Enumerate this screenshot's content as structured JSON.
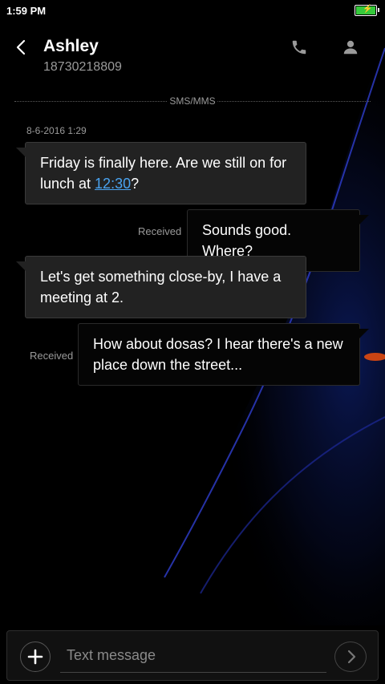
{
  "status": {
    "time": "1:59 PM"
  },
  "header": {
    "contact_name": "Ashley",
    "contact_number": "18730218809"
  },
  "thread": {
    "channel_label": "SMS/MMS",
    "timestamp": "8-6-2016 1:29",
    "messages": [
      {
        "direction": "incoming",
        "text_before": "Friday is finally here. Are we still on for lunch at ",
        "link": "12:30",
        "text_after": "?"
      },
      {
        "direction": "outgoing",
        "status": "Received",
        "text": "Sounds good. Where?"
      },
      {
        "direction": "incoming",
        "text": "Let's get something close-by, I have a meeting at 2."
      },
      {
        "direction": "outgoing",
        "status": "Received",
        "text": "How about dosas? I hear there's a new place down the street..."
      }
    ]
  },
  "compose": {
    "placeholder": "Text message"
  },
  "colors": {
    "link": "#4aa3f0",
    "battery": "#35c93b",
    "bubble_incoming": "#222222",
    "bubble_outgoing": "#050505"
  },
  "icons": [
    "back-icon",
    "phone-icon",
    "person-icon",
    "plus-icon",
    "send-icon",
    "battery-icon"
  ]
}
